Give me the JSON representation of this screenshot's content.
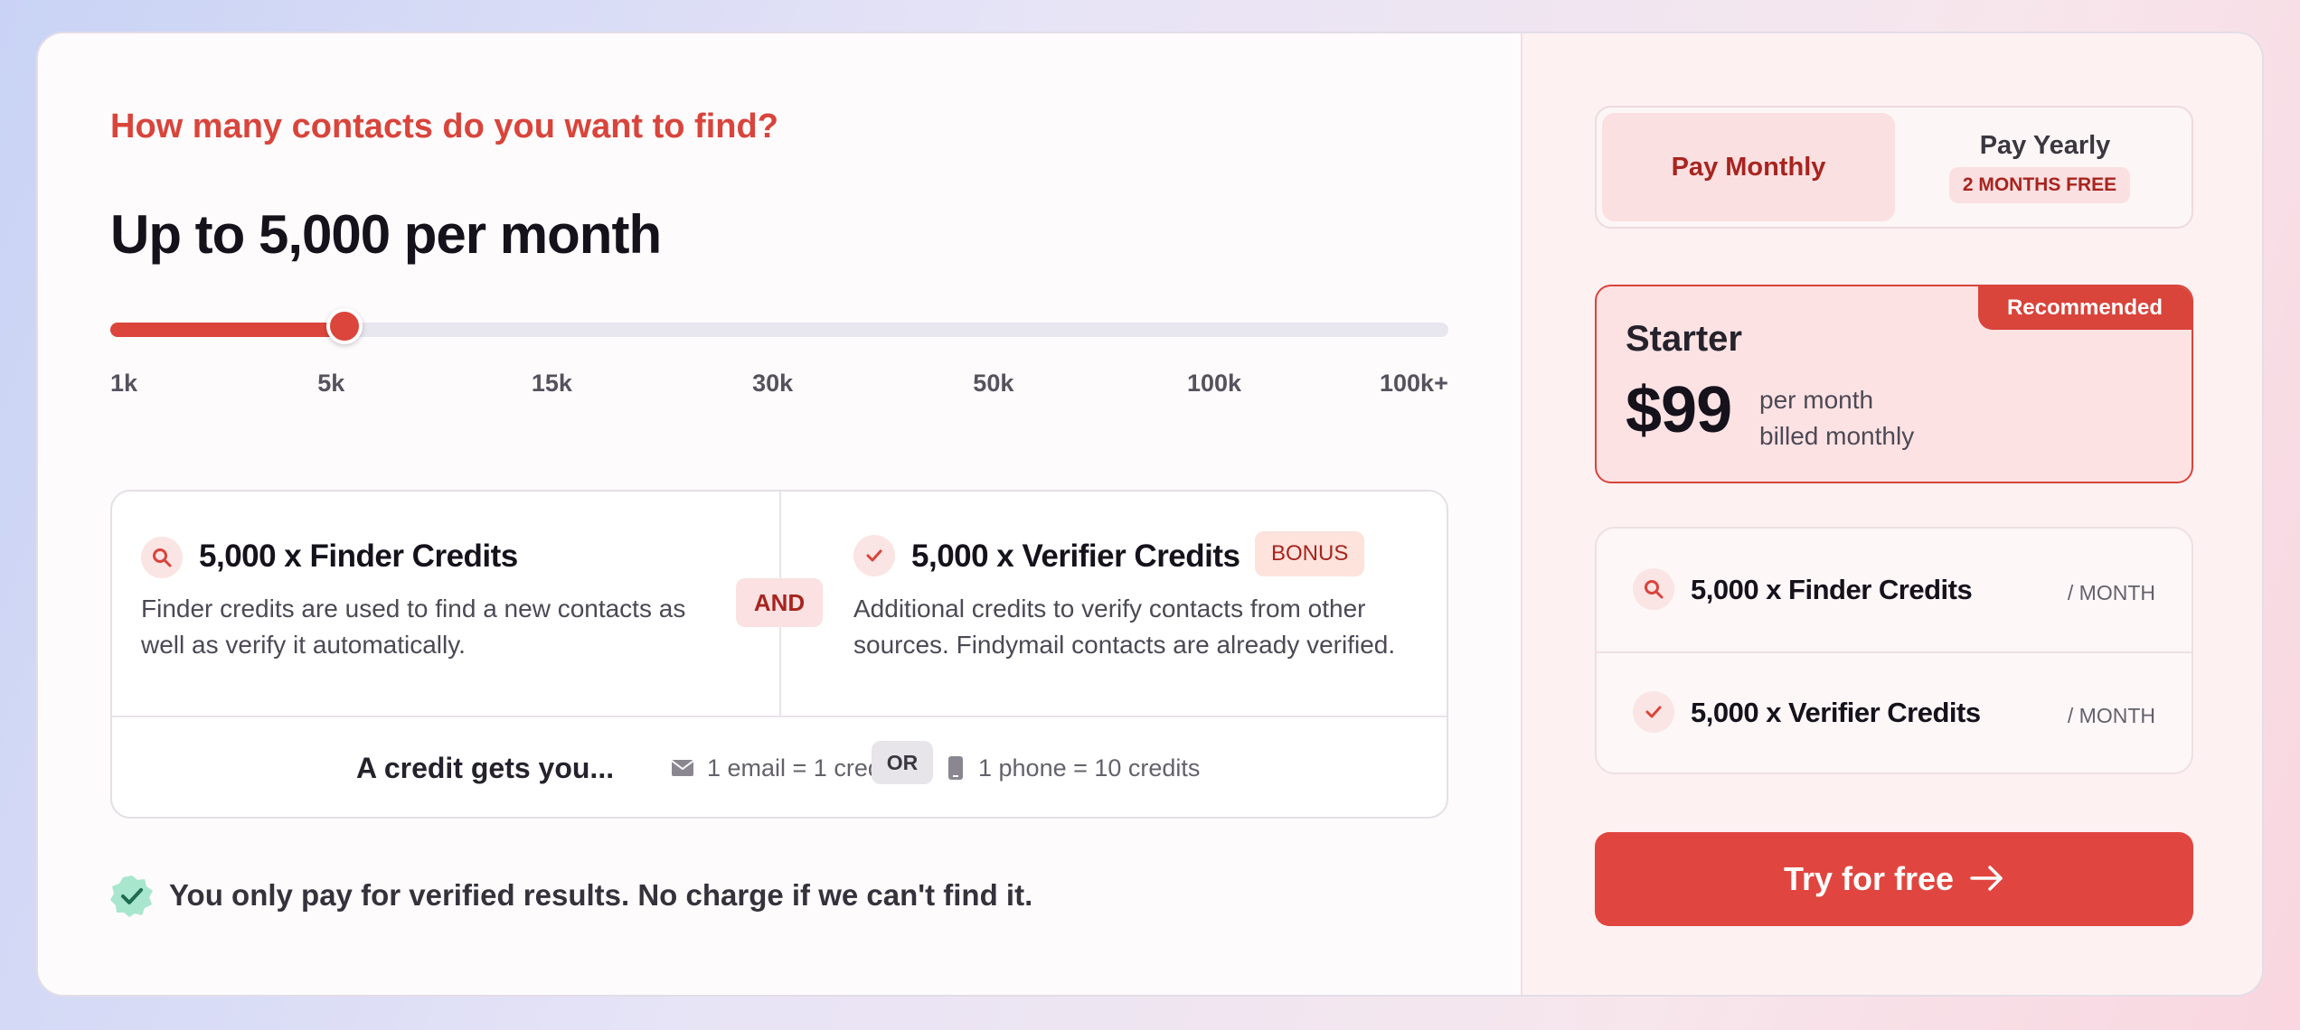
{
  "question": "How many contacts do you want to find?",
  "headline": "Up to 5,000 per month",
  "slider": {
    "ticks": [
      "1k",
      "5k",
      "15k",
      "30k",
      "50k",
      "100k",
      "100k+"
    ],
    "selected_index": 1,
    "progress_fraction": 0.175
  },
  "finder": {
    "title": "5,000 x Finder Credits",
    "description": "Finder credits are used to find a new contacts as well as verify it automatically."
  },
  "and_label": "AND",
  "verifier": {
    "title": "5,000 x Verifier Credits",
    "badge": "BONUS",
    "description": "Additional credits to verify contacts from other sources. Findymail contacts are already verified."
  },
  "credit_gets": {
    "label": "A credit gets you...",
    "email": "1 email = 1 credit",
    "or": "OR",
    "phone": "1 phone = 10 credits"
  },
  "guarantee": "You only pay for verified results. No charge if we can't find it.",
  "billing": {
    "monthly": "Pay Monthly",
    "yearly": "Pay Yearly",
    "yearly_badge": "2 MONTHS FREE",
    "selected": "monthly"
  },
  "plan": {
    "badge": "Recommended",
    "name": "Starter",
    "price": "$99",
    "per": "per month",
    "billed": "billed monthly"
  },
  "summary": [
    {
      "title": "5,000 x Finder Credits",
      "unit": "/ MONTH",
      "icon": "search-icon"
    },
    {
      "title": "5,000 x Verifier Credits",
      "unit": "/ MONTH",
      "icon": "check-icon"
    }
  ],
  "cta": "Try for free",
  "colors": {
    "accent": "#dc453c",
    "accent_soft": "#fbe1e1",
    "success": "#a8e6cd"
  }
}
